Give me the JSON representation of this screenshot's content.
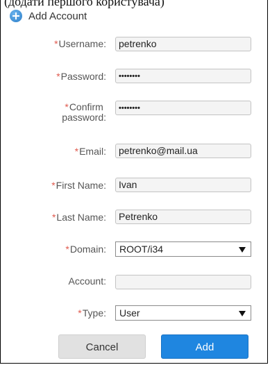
{
  "caption": "(додати першого користувача)",
  "header": {
    "title": "Add Account",
    "icon": "add-circle-icon"
  },
  "form": {
    "required_marker": "*",
    "username": {
      "label": "Username:",
      "value": "petrenko"
    },
    "password": {
      "label": "Password:",
      "value": "••••••••"
    },
    "confirm_password": {
      "label_line1": "Confirm",
      "label_line2": "password:",
      "value": "••••••••"
    },
    "email": {
      "label": "Email:",
      "value": "petrenko@mail.ua"
    },
    "first_name": {
      "label": "First Name:",
      "value": "Ivan"
    },
    "last_name": {
      "label": "Last Name:",
      "value": "Petrenko"
    },
    "domain": {
      "label": "Domain:",
      "value": "ROOT/i34"
    },
    "account": {
      "label": "Account:",
      "value": ""
    },
    "type": {
      "label": "Type:",
      "value": "User"
    }
  },
  "buttons": {
    "cancel": "Cancel",
    "add": "Add"
  },
  "colors": {
    "required": "#e05a4e",
    "primary": "#1f86e0"
  }
}
